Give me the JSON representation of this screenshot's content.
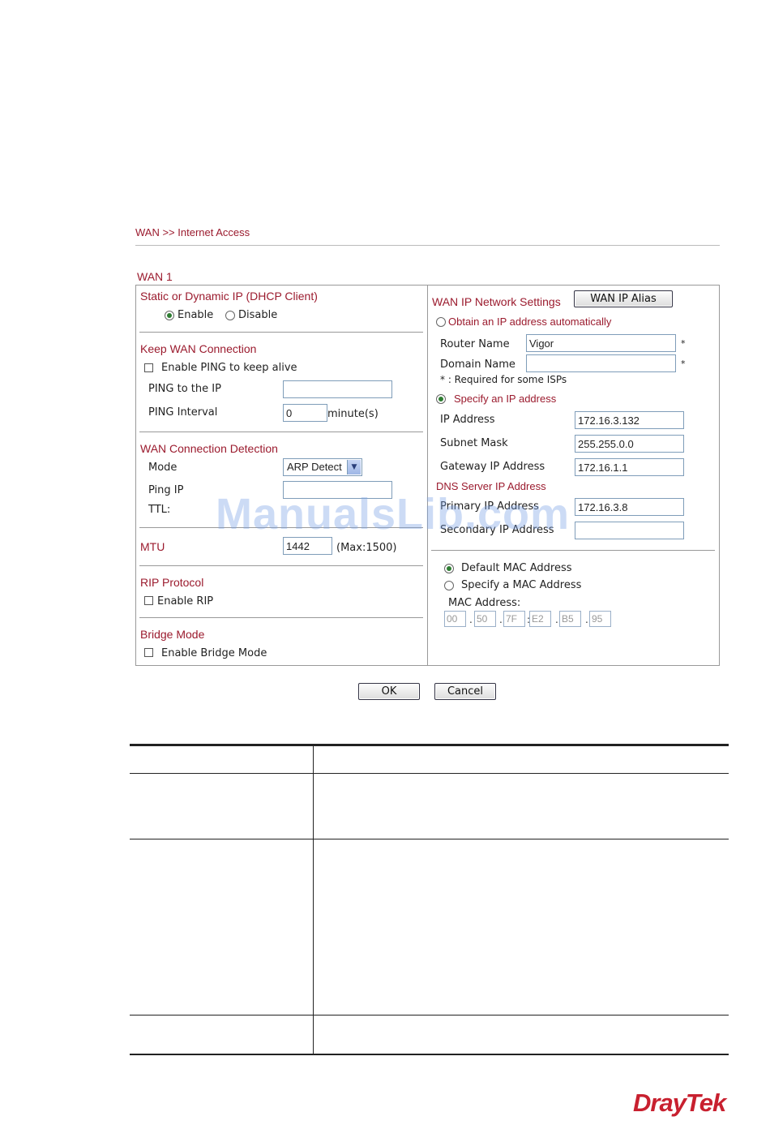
{
  "breadcrumb": "WAN >> Internet Access",
  "wan_title": "WAN 1",
  "left": {
    "static_dynamic": {
      "heading": "Static or Dynamic IP (DHCP Client)",
      "enable_label": "Enable",
      "disable_label": "Disable",
      "selected": "Enable"
    },
    "keep_wan": {
      "heading": "Keep WAN Connection",
      "enable_ping_label": "Enable PING to keep alive",
      "ping_to_ip_label": "PING to the IP",
      "ping_to_ip_value": "",
      "ping_interval_label": "PING Interval",
      "ping_interval_value": "0",
      "ping_interval_unit": "minute(s)"
    },
    "detection": {
      "heading": "WAN Connection Detection",
      "mode_label": "Mode",
      "mode_value": "ARP Detect",
      "ping_ip_label": "Ping IP",
      "ping_ip_value": "",
      "ttl_label": "TTL:"
    },
    "mtu": {
      "label": "MTU",
      "value": "1442",
      "max_text": "(Max:1500)"
    },
    "rip": {
      "heading": "RIP Protocol",
      "enable_label": "Enable RIP"
    },
    "bridge": {
      "heading": "Bridge Mode",
      "enable_label": "Enable Bridge Mode"
    }
  },
  "right": {
    "heading": "WAN IP Network Settings",
    "alias_button": "WAN IP Alias",
    "obtain_label": "Obtain an IP address automatically",
    "router_name_label": "Router Name",
    "router_name_value": "Vigor",
    "domain_name_label": "Domain Name",
    "domain_name_value": "",
    "asterisk": "*",
    "required_note": "* : Required for some ISPs",
    "specify_label": "Specify an IP address",
    "ip_address_label": "IP Address",
    "ip_address_value": "172.16.3.132",
    "subnet_mask_label": "Subnet Mask",
    "subnet_mask_value": "255.255.0.0",
    "gateway_label": "Gateway IP Address",
    "gateway_value": "172.16.1.1",
    "dns_heading": "DNS Server IP Address",
    "primary_label": "Primary IP Address",
    "primary_value": "172.16.3.8",
    "secondary_label": "Secondary IP Address",
    "secondary_value": "",
    "default_mac_label": "Default MAC Address",
    "specify_mac_label": "Specify a MAC Address",
    "mac_label": "MAC Address:",
    "mac_octets": [
      "00",
      "50",
      "7F",
      "E2",
      "B5",
      "95"
    ]
  },
  "buttons": {
    "ok": "OK",
    "cancel": "Cancel"
  },
  "watermark": "ManualsLib.com",
  "logo": "DrayTek"
}
